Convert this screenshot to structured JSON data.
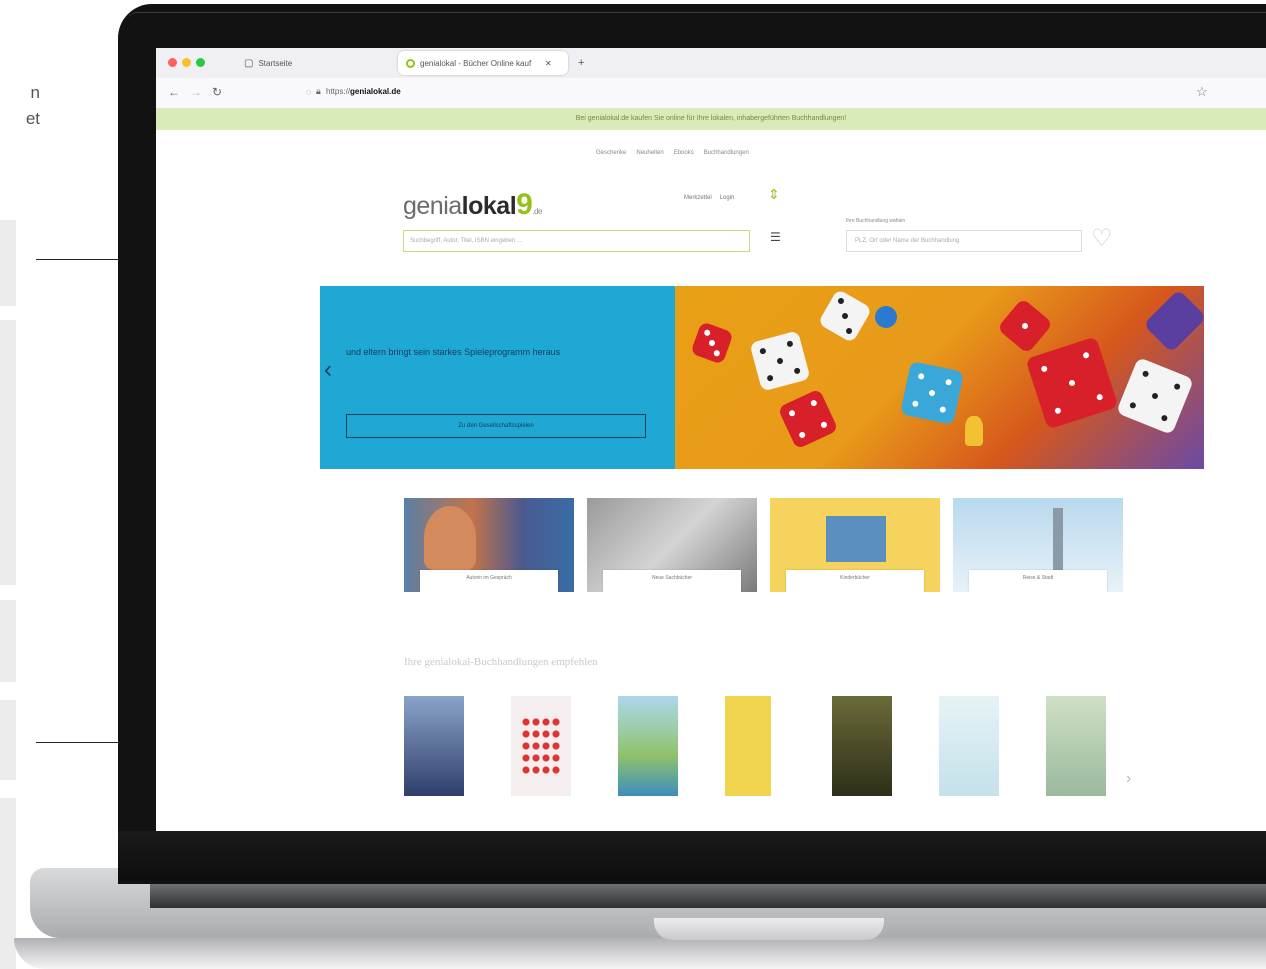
{
  "annotation": {
    "left_text_lines": [
      "n",
      "et"
    ]
  },
  "browser": {
    "tabs": [
      {
        "label": "Startseite"
      },
      {
        "label": "genialokal - Bücher Online kauf",
        "close": "✕"
      }
    ],
    "new_tab": "+",
    "nav": {
      "back": "←",
      "forward": "→",
      "reload": "↻"
    },
    "url_prefix": "https://",
    "url_domain": "genialokal.de",
    "bookmark_icon": "☆"
  },
  "page": {
    "promo_text": "Bei genialokal.de kaufen Sie online für Ihre lokalen, inhabergeführten Buchhandlungen!",
    "top_nav": [
      "Geschenke",
      "Neuheiten",
      "Ebooks",
      "Buchhandlungen"
    ],
    "logo": {
      "light": "genia",
      "bold": "lokal",
      "nine": "9",
      "tld": ".de"
    },
    "account": [
      "Merkzettel",
      "Login"
    ],
    "search_placeholder": "Suchbegriff, Autor, Titel, ISBN eingeben …",
    "store_label": "Ihre Buchhandlung wählen",
    "store_placeholder": "PLZ, Ort oder Name der Buchhandlung",
    "hero": {
      "text": "und eltern bringt sein starkes Spieleprogramm heraus",
      "button": "Zu den Gesellschaftsspielen",
      "prev": "‹"
    },
    "cards": [
      {
        "caption": "Autorin im Gespräch"
      },
      {
        "caption": "Neue Sachbücher"
      },
      {
        "caption": "Kinderbücher"
      },
      {
        "caption": "Reise & Stadt"
      }
    ],
    "section_title": "Ihre genialokal-Buchhandlungen empfehlen",
    "books_next": "›"
  },
  "colors": {
    "brand_green": "#95c11f",
    "promo_bg": "#d9ebb9",
    "hero_blue": "#1fa8d4"
  }
}
